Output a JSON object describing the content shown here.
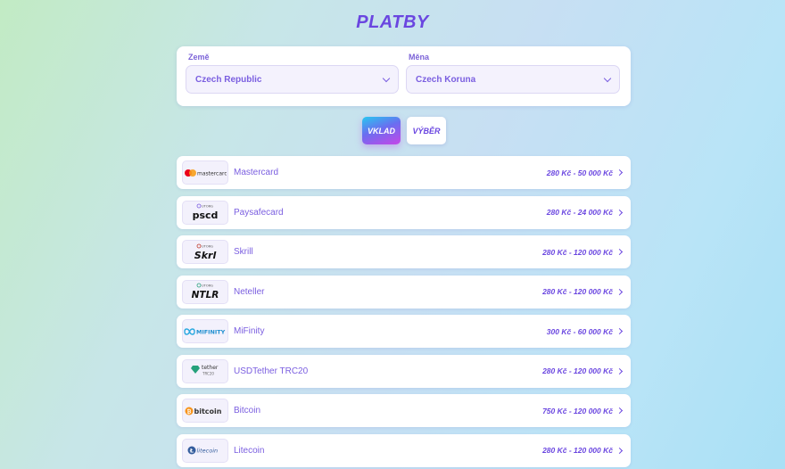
{
  "page_title": "PLATBY",
  "filters": {
    "country_label": "Země",
    "country_value": "Czech Republic",
    "currency_label": "Měna",
    "currency_value": "Czech Koruna"
  },
  "tabs": {
    "deposit": "VKLAD",
    "withdraw": "VÝBĚR"
  },
  "methods": [
    {
      "name": "Mastercard",
      "range": "280 Kč - 50 000 Kč",
      "logo_icon": "mastercard-logo",
      "logo_text": "mastercard"
    },
    {
      "name": "Paysafecard",
      "range": "280 Kč - 24 000 Kč",
      "logo_icon": "paysafecard-logo",
      "logo_top": "UTORG",
      "logo_text": "pscd"
    },
    {
      "name": "Skrill",
      "range": "280 Kč - 120 000 Kč",
      "logo_icon": "skrill-logo",
      "logo_top": "UTORG",
      "logo_text": "Skrl"
    },
    {
      "name": "Neteller",
      "range": "280 Kč - 120 000 Kč",
      "logo_icon": "neteller-logo",
      "logo_top": "UTORG",
      "logo_text": "NTLR"
    },
    {
      "name": "MiFinity",
      "range": "300 Kč - 60 000 Kč",
      "logo_icon": "mifinity-logo",
      "logo_text": "MIFINITY"
    },
    {
      "name": "USDTether TRC20",
      "range": "280 Kč - 120 000 Kč",
      "logo_icon": "tether-logo",
      "logo_text": "tether",
      "logo_sub": "TRC20"
    },
    {
      "name": "Bitcoin",
      "range": "750 Kč - 120 000 Kč",
      "logo_icon": "bitcoin-logo",
      "logo_text": "bitcoin"
    },
    {
      "name": "Litecoin",
      "range": "280 Kč - 120 000 Kč",
      "logo_icon": "litecoin-logo",
      "logo_text": "litecoin"
    }
  ],
  "colors": {
    "accent": "#6a46e0",
    "text_purple": "#7a5ee0",
    "mastercard_red": "#eb001b",
    "mastercard_orange": "#f79e1b",
    "bitcoin_orange": "#f7931a",
    "litecoin_blue": "#345d9d",
    "tether_green": "#26a17b"
  }
}
